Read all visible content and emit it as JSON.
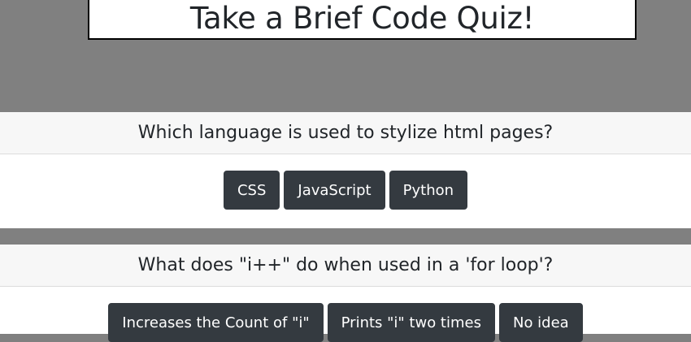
{
  "header": {
    "title": "Take a Brief Code Quiz!"
  },
  "questions": [
    {
      "question": "Which language is used to stylize html pages?",
      "answers": [
        "CSS",
        "JavaScript",
        "Python"
      ]
    },
    {
      "question": "What does \"i++\" do when used in a 'for loop'?",
      "answers": [
        "Increases the Count of \"i\"",
        "Prints \"i\" two times",
        "No idea"
      ]
    }
  ],
  "colors": {
    "page_background": "#808080",
    "button_background": "#343a40",
    "card_header_background": "#f7f7f7"
  }
}
